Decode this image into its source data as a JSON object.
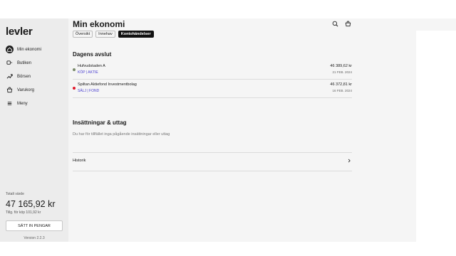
{
  "brand": {
    "logo": "levler"
  },
  "sidebar": {
    "items": [
      {
        "label": "Min ekonomi",
        "icon": "home-icon",
        "active": true
      },
      {
        "label": "Butiken",
        "icon": "store-icon",
        "active": false
      },
      {
        "label": "Börsen",
        "icon": "trend-up-icon",
        "active": false
      },
      {
        "label": "Varukorg",
        "icon": "cart-icon",
        "active": false
      },
      {
        "label": "Meny",
        "icon": "menu-icon",
        "active": false
      }
    ],
    "balance_label": "Totalt värde",
    "balance": "47 165,92 kr",
    "available": "Tillg. för köp 101,92 kr",
    "deposit_button": "SÄTT IN PENGAR",
    "version": "Version 2.2.3"
  },
  "header": {
    "title": "Min ekonomi",
    "tabs": [
      {
        "label": "Översikt",
        "active": false
      },
      {
        "label": "Innehav",
        "active": false
      },
      {
        "label": "Kontohändelser",
        "active": true
      }
    ]
  },
  "trades": {
    "title": "Dagens avslut",
    "rows": [
      {
        "name": "Hufvudstaden A",
        "meta": "KÖP | AKTIE",
        "amount": "46 389,62 kr",
        "date": "21 FEB. 2024",
        "status_color": "#7a8a6a"
      },
      {
        "name": "Spiltan Aktiefond Investmentbolag",
        "meta": "SÄLJ | FOND",
        "amount": "46 372,81 kr",
        "date": "16 FEB. 2024",
        "status_color": "#e0182d"
      }
    ]
  },
  "transfers": {
    "title": "Insättningar & uttag",
    "empty_text": "Du har för tillfället inga pågående insättningar eller uttag",
    "history_label": "Historik"
  },
  "colors": {
    "accent": "#4a3fd0",
    "active_tab": "#111111",
    "sell": "#e0182d",
    "buy": "#7a8a6a"
  }
}
